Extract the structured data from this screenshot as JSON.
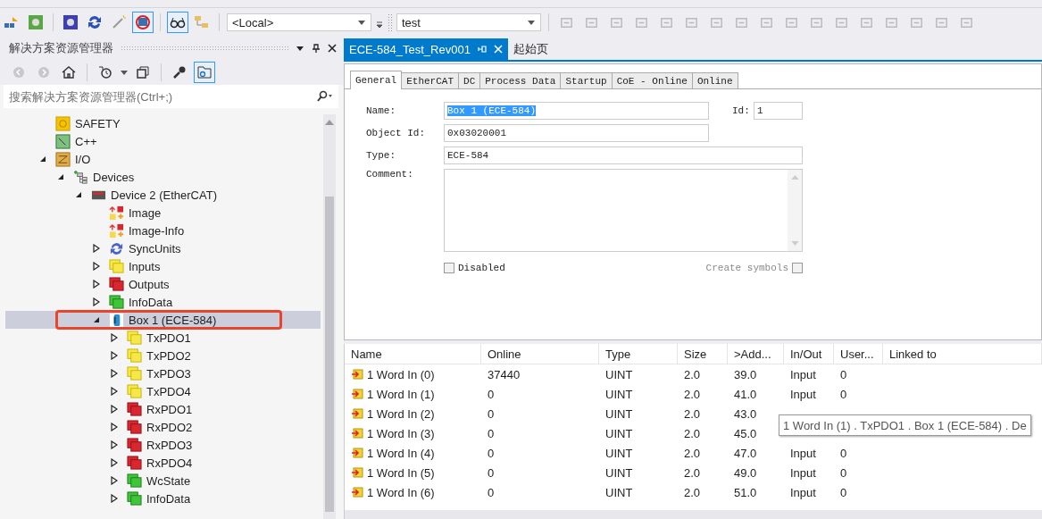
{
  "toolbar": {
    "platform_combo": "<Local>",
    "project_combo": "test"
  },
  "solution_explorer": {
    "title": "解决方案资源管理器",
    "search": {
      "placeholder": "搜索解决方案资源管理器(Ctrl+;)"
    },
    "tree": [
      {
        "label": "SAFETY",
        "kind": "safety",
        "selected": false
      },
      {
        "label": "C++",
        "kind": "cpp",
        "selected": false
      },
      {
        "label": "I/O",
        "kind": "io",
        "selected": false,
        "expanded": true,
        "children": [
          {
            "label": "Devices",
            "kind": "devices",
            "selected": false,
            "expanded": true,
            "children": [
              {
                "label": "Device 2 (EtherCAT)",
                "kind": "device",
                "selected": false,
                "expanded": true,
                "children": [
                  {
                    "label": "Image",
                    "kind": "image",
                    "selected": false
                  },
                  {
                    "label": "Image-Info",
                    "kind": "image",
                    "selected": false
                  },
                  {
                    "label": "SyncUnits",
                    "kind": "sync",
                    "selected": false,
                    "expanded": false
                  },
                  {
                    "label": "Inputs",
                    "kind": "yellow",
                    "selected": false,
                    "expanded": false
                  },
                  {
                    "label": "Outputs",
                    "kind": "red",
                    "selected": false,
                    "expanded": false
                  },
                  {
                    "label": "InfoData",
                    "kind": "green",
                    "selected": false,
                    "expanded": false
                  },
                  {
                    "label": "Box 1 (ECE-584)",
                    "kind": "box",
                    "selected": true,
                    "annotated": true,
                    "expanded": true,
                    "children": [
                      {
                        "label": "TxPDO1",
                        "kind": "yellow",
                        "selected": false,
                        "expanded": false
                      },
                      {
                        "label": "TxPDO2",
                        "kind": "yellow",
                        "selected": false,
                        "expanded": false
                      },
                      {
                        "label": "TxPDO3",
                        "kind": "yellow",
                        "selected": false,
                        "expanded": false
                      },
                      {
                        "label": "TxPDO4",
                        "kind": "yellow",
                        "selected": false,
                        "expanded": false
                      },
                      {
                        "label": "RxPDO1",
                        "kind": "red",
                        "selected": false,
                        "expanded": false
                      },
                      {
                        "label": "RxPDO2",
                        "kind": "red",
                        "selected": false,
                        "expanded": false
                      },
                      {
                        "label": "RxPDO3",
                        "kind": "red",
                        "selected": false,
                        "expanded": false
                      },
                      {
                        "label": "RxPDO4",
                        "kind": "red",
                        "selected": false,
                        "expanded": false
                      },
                      {
                        "label": "WcState",
                        "kind": "green",
                        "selected": false,
                        "expanded": false
                      },
                      {
                        "label": "InfoData",
                        "kind": "green",
                        "selected": false,
                        "expanded": false
                      }
                    ]
                  }
                ]
              }
            ]
          }
        ]
      }
    ]
  },
  "document_tabs": [
    {
      "label": "ECE-584_Test_Rev001",
      "selected": true
    },
    {
      "label": "起始页",
      "selected": false
    }
  ],
  "property_tabs": [
    {
      "label": "General",
      "selected": true
    },
    {
      "label": "EtherCAT",
      "selected": false
    },
    {
      "label": "DC",
      "selected": false
    },
    {
      "label": "Process Data",
      "selected": false
    },
    {
      "label": "Startup",
      "selected": false
    },
    {
      "label": "CoE - Online",
      "selected": false
    },
    {
      "label": "Online",
      "selected": false
    }
  ],
  "form": {
    "name": {
      "label": "Name:",
      "value": "Box 1 (ECE-584)",
      "text_selected": true
    },
    "id": {
      "label": "Id:",
      "value": "1"
    },
    "object_id": {
      "label": "Object Id:",
      "value": "0x03020001"
    },
    "type": {
      "label": "Type:",
      "value": "ECE-584"
    },
    "comment": {
      "label": "Comment:"
    },
    "disabled": {
      "label": "Disabled",
      "checked": false
    },
    "create_symbols": {
      "label": "Create symbols",
      "checked": false,
      "disabled": true
    }
  },
  "table": {
    "columns": [
      "Name",
      "Online",
      "Type",
      "Size",
      ">Add...",
      "In/Out",
      "User...",
      "Linked to"
    ],
    "rows": [
      [
        "1 Word In (0)",
        "37440",
        "UINT",
        "2.0",
        "39.0",
        "Input",
        "0"
      ],
      [
        "1 Word In (1)",
        "0",
        "UINT",
        "2.0",
        "41.0",
        "Input",
        "0"
      ],
      [
        "1 Word In (2)",
        "0",
        "UINT",
        "2.0",
        "43.0"
      ],
      [
        "1 Word In (3)",
        "0",
        "UINT",
        "2.0",
        "45.0"
      ],
      [
        "1 Word In (4)",
        "0",
        "UINT",
        "2.0",
        "47.0",
        "Input",
        "0"
      ],
      [
        "1 Word In (5)",
        "0",
        "UINT",
        "2.0",
        "49.0",
        "Input",
        "0"
      ],
      [
        "1 Word In (6)",
        "0",
        "UINT",
        "2.0",
        "51.0",
        "Input",
        "0"
      ]
    ]
  },
  "tooltip": "1 Word In (1) . TxPDO1 . Box 1 (ECE-584) . De"
}
